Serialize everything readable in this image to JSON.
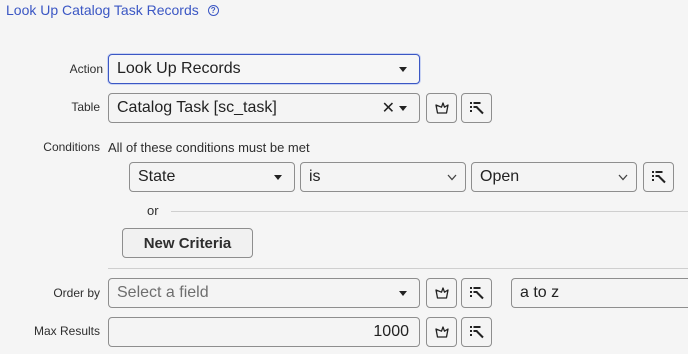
{
  "header": {
    "title": "Look Up Catalog Task Records",
    "help_icon": "help-circle-icon"
  },
  "action": {
    "label": "Action",
    "value": "Look Up Records"
  },
  "table": {
    "label": "Table",
    "value": "Catalog Task [sc_task]",
    "clear_glyph": "✕"
  },
  "conditions": {
    "label": "Conditions",
    "description": "All of these conditions must be met",
    "field": "State",
    "operator": "is",
    "value": "Open",
    "or_label": "or",
    "new_criteria": "New Criteria"
  },
  "order_by": {
    "label": "Order by",
    "placeholder": "Select a field",
    "direction": "a to z"
  },
  "max_results": {
    "label": "Max Results",
    "value": "1000"
  },
  "colors": {
    "accent": "#3b57c4",
    "border": "#8e8e8e",
    "background": "#f5f5f5"
  }
}
